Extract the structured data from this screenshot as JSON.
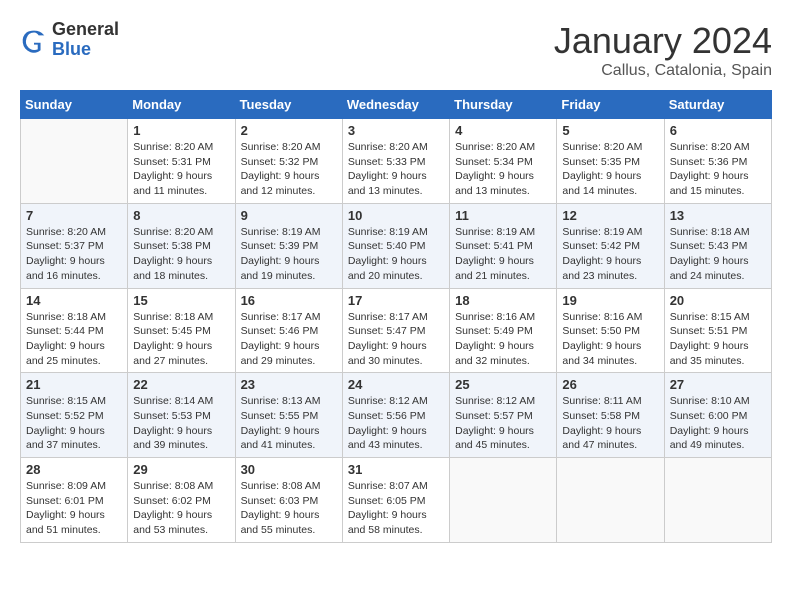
{
  "header": {
    "logo_general": "General",
    "logo_blue": "Blue",
    "title": "January 2024",
    "subtitle": "Callus, Catalonia, Spain"
  },
  "days_of_week": [
    "Sunday",
    "Monday",
    "Tuesday",
    "Wednesday",
    "Thursday",
    "Friday",
    "Saturday"
  ],
  "weeks": [
    [
      {
        "day": "",
        "empty": true
      },
      {
        "day": "1",
        "sunrise": "Sunrise: 8:20 AM",
        "sunset": "Sunset: 5:31 PM",
        "daylight": "Daylight: 9 hours and 11 minutes."
      },
      {
        "day": "2",
        "sunrise": "Sunrise: 8:20 AM",
        "sunset": "Sunset: 5:32 PM",
        "daylight": "Daylight: 9 hours and 12 minutes."
      },
      {
        "day": "3",
        "sunrise": "Sunrise: 8:20 AM",
        "sunset": "Sunset: 5:33 PM",
        "daylight": "Daylight: 9 hours and 13 minutes."
      },
      {
        "day": "4",
        "sunrise": "Sunrise: 8:20 AM",
        "sunset": "Sunset: 5:34 PM",
        "daylight": "Daylight: 9 hours and 13 minutes."
      },
      {
        "day": "5",
        "sunrise": "Sunrise: 8:20 AM",
        "sunset": "Sunset: 5:35 PM",
        "daylight": "Daylight: 9 hours and 14 minutes."
      },
      {
        "day": "6",
        "sunrise": "Sunrise: 8:20 AM",
        "sunset": "Sunset: 5:36 PM",
        "daylight": "Daylight: 9 hours and 15 minutes."
      }
    ],
    [
      {
        "day": "7",
        "sunrise": "Sunrise: 8:20 AM",
        "sunset": "Sunset: 5:37 PM",
        "daylight": "Daylight: 9 hours and 16 minutes."
      },
      {
        "day": "8",
        "sunrise": "Sunrise: 8:20 AM",
        "sunset": "Sunset: 5:38 PM",
        "daylight": "Daylight: 9 hours and 18 minutes."
      },
      {
        "day": "9",
        "sunrise": "Sunrise: 8:19 AM",
        "sunset": "Sunset: 5:39 PM",
        "daylight": "Daylight: 9 hours and 19 minutes."
      },
      {
        "day": "10",
        "sunrise": "Sunrise: 8:19 AM",
        "sunset": "Sunset: 5:40 PM",
        "daylight": "Daylight: 9 hours and 20 minutes."
      },
      {
        "day": "11",
        "sunrise": "Sunrise: 8:19 AM",
        "sunset": "Sunset: 5:41 PM",
        "daylight": "Daylight: 9 hours and 21 minutes."
      },
      {
        "day": "12",
        "sunrise": "Sunrise: 8:19 AM",
        "sunset": "Sunset: 5:42 PM",
        "daylight": "Daylight: 9 hours and 23 minutes."
      },
      {
        "day": "13",
        "sunrise": "Sunrise: 8:18 AM",
        "sunset": "Sunset: 5:43 PM",
        "daylight": "Daylight: 9 hours and 24 minutes."
      }
    ],
    [
      {
        "day": "14",
        "sunrise": "Sunrise: 8:18 AM",
        "sunset": "Sunset: 5:44 PM",
        "daylight": "Daylight: 9 hours and 25 minutes."
      },
      {
        "day": "15",
        "sunrise": "Sunrise: 8:18 AM",
        "sunset": "Sunset: 5:45 PM",
        "daylight": "Daylight: 9 hours and 27 minutes."
      },
      {
        "day": "16",
        "sunrise": "Sunrise: 8:17 AM",
        "sunset": "Sunset: 5:46 PM",
        "daylight": "Daylight: 9 hours and 29 minutes."
      },
      {
        "day": "17",
        "sunrise": "Sunrise: 8:17 AM",
        "sunset": "Sunset: 5:47 PM",
        "daylight": "Daylight: 9 hours and 30 minutes."
      },
      {
        "day": "18",
        "sunrise": "Sunrise: 8:16 AM",
        "sunset": "Sunset: 5:49 PM",
        "daylight": "Daylight: 9 hours and 32 minutes."
      },
      {
        "day": "19",
        "sunrise": "Sunrise: 8:16 AM",
        "sunset": "Sunset: 5:50 PM",
        "daylight": "Daylight: 9 hours and 34 minutes."
      },
      {
        "day": "20",
        "sunrise": "Sunrise: 8:15 AM",
        "sunset": "Sunset: 5:51 PM",
        "daylight": "Daylight: 9 hours and 35 minutes."
      }
    ],
    [
      {
        "day": "21",
        "sunrise": "Sunrise: 8:15 AM",
        "sunset": "Sunset: 5:52 PM",
        "daylight": "Daylight: 9 hours and 37 minutes."
      },
      {
        "day": "22",
        "sunrise": "Sunrise: 8:14 AM",
        "sunset": "Sunset: 5:53 PM",
        "daylight": "Daylight: 9 hours and 39 minutes."
      },
      {
        "day": "23",
        "sunrise": "Sunrise: 8:13 AM",
        "sunset": "Sunset: 5:55 PM",
        "daylight": "Daylight: 9 hours and 41 minutes."
      },
      {
        "day": "24",
        "sunrise": "Sunrise: 8:12 AM",
        "sunset": "Sunset: 5:56 PM",
        "daylight": "Daylight: 9 hours and 43 minutes."
      },
      {
        "day": "25",
        "sunrise": "Sunrise: 8:12 AM",
        "sunset": "Sunset: 5:57 PM",
        "daylight": "Daylight: 9 hours and 45 minutes."
      },
      {
        "day": "26",
        "sunrise": "Sunrise: 8:11 AM",
        "sunset": "Sunset: 5:58 PM",
        "daylight": "Daylight: 9 hours and 47 minutes."
      },
      {
        "day": "27",
        "sunrise": "Sunrise: 8:10 AM",
        "sunset": "Sunset: 6:00 PM",
        "daylight": "Daylight: 9 hours and 49 minutes."
      }
    ],
    [
      {
        "day": "28",
        "sunrise": "Sunrise: 8:09 AM",
        "sunset": "Sunset: 6:01 PM",
        "daylight": "Daylight: 9 hours and 51 minutes."
      },
      {
        "day": "29",
        "sunrise": "Sunrise: 8:08 AM",
        "sunset": "Sunset: 6:02 PM",
        "daylight": "Daylight: 9 hours and 53 minutes."
      },
      {
        "day": "30",
        "sunrise": "Sunrise: 8:08 AM",
        "sunset": "Sunset: 6:03 PM",
        "daylight": "Daylight: 9 hours and 55 minutes."
      },
      {
        "day": "31",
        "sunrise": "Sunrise: 8:07 AM",
        "sunset": "Sunset: 6:05 PM",
        "daylight": "Daylight: 9 hours and 58 minutes."
      },
      {
        "day": "",
        "empty": true
      },
      {
        "day": "",
        "empty": true
      },
      {
        "day": "",
        "empty": true
      }
    ]
  ]
}
